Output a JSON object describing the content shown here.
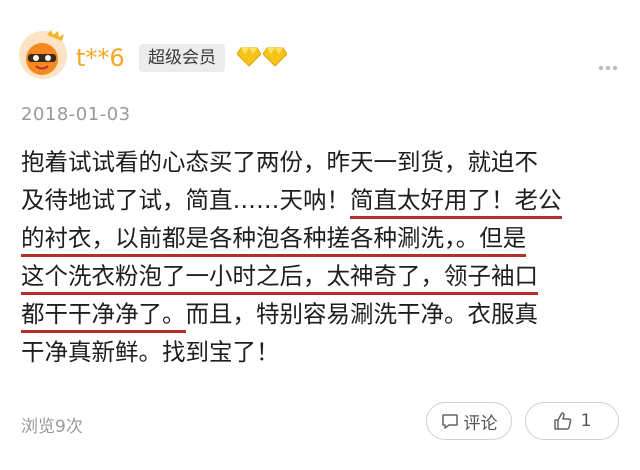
{
  "user": {
    "name": "t**6",
    "member_badge": "超级会员",
    "gem_count": 2,
    "avatar_color": "#f5891f",
    "name_color": "#f5a623"
  },
  "post": {
    "date": "2018-01-03",
    "lines": [
      {
        "before": "抱着试试看的心态买了两份，昨天一到货，就迫不",
        "underlined": "",
        "after": ""
      },
      {
        "before": "及待地试了试，简直……天呐！",
        "underlined": "简直太好用了！老公",
        "after": ""
      },
      {
        "before": "",
        "underlined": "的衬衣，以前都是各种泡各种搓各种涮洗，。但是",
        "after": ""
      },
      {
        "before": "",
        "underlined": "这个洗衣粉泡了一小时之后，太神奇了，领子袖口",
        "after": ""
      },
      {
        "before": "",
        "underlined": "都干干净净了。",
        "after": "而且，特别容易涮洗干净。衣服真"
      },
      {
        "before": "干净真新鲜。找到宝了！",
        "underlined": "",
        "after": ""
      }
    ],
    "underline_color": "#b5302b"
  },
  "footer": {
    "views": "浏览9次",
    "comment_label": "评论",
    "like_count": "1"
  }
}
